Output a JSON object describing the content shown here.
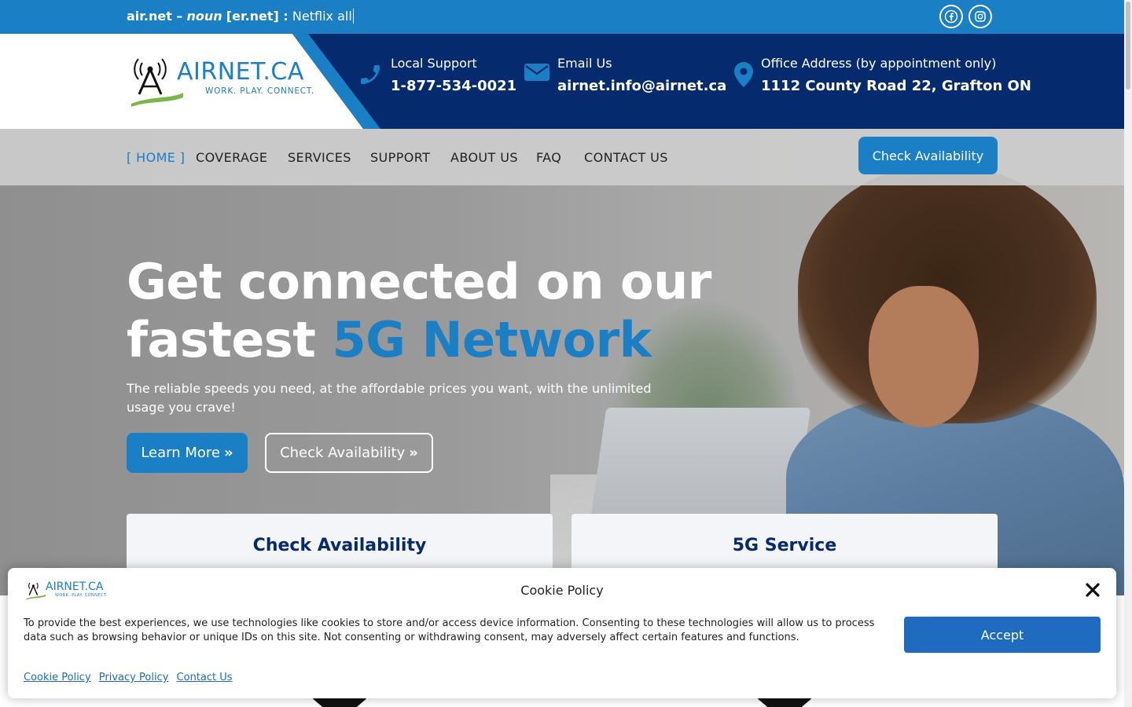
{
  "topbar": {
    "ticker_word": "air.net –",
    "ticker_pos": "noun",
    "ticker_pron": "[er.net] :",
    "ticker_typed": "Netflix all",
    "social": [
      "facebook-icon",
      "instagram-icon"
    ]
  },
  "header": {
    "logo_brand": "AIRNET.CA",
    "logo_tagline": "WORK. PLAY. CONNECT.",
    "contacts": [
      {
        "label": "Local Support",
        "value": "1-877-534-0021",
        "icon": "phone-icon"
      },
      {
        "label": "Email Us",
        "value": "airnet.info@airnet.ca",
        "icon": "envelope-icon"
      },
      {
        "label": "Office Address (by appointment only)",
        "value": "1112 County Road 22, Grafton ON",
        "icon": "map-pin-icon"
      }
    ]
  },
  "nav": {
    "bracket_open": "[",
    "bracket_close": "]",
    "items": [
      "HOME",
      "COVERAGE",
      "SERVICES",
      "SUPPORT",
      "ABOUT US",
      "FAQ",
      "CONTACT US"
    ],
    "active": "HOME",
    "cta": "Check Availability"
  },
  "hero": {
    "title_line1": "Get connected on our",
    "title_line2_plain": "fastest",
    "title_line2_accent": "5G Network",
    "subtitle": "The reliable speeds you need, at the affordable prices you want, with the unlimited usage you crave!",
    "btn_learn": "Learn More",
    "btn_avail": "Check Availability",
    "chevrons": "»"
  },
  "cards": [
    {
      "title": "Check Availability"
    },
    {
      "title": "5G Service"
    }
  ],
  "cookie": {
    "title": "Cookie Policy",
    "text": "To provide the best experiences, we use technologies like cookies to store and/or access device information. Consenting to these technologies will allow us to process data such as browsing behavior or unique IDs on this site. Not consenting or withdrawing consent, may adversely affect certain features and functions.",
    "accept": "Accept",
    "links": [
      "Cookie Policy",
      "Privacy Policy",
      "Contact Us"
    ],
    "logo_brand": "AIRNET.CA",
    "logo_tagline": "WORK. PLAY. CONNECT."
  },
  "colors": {
    "brand_blue": "#1a7fc4",
    "navy": "#062a6e",
    "accept_blue": "#1e6bbf"
  }
}
